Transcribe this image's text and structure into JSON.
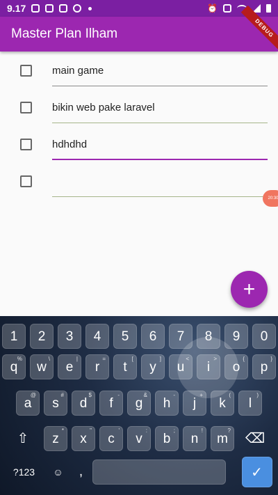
{
  "statusbar": {
    "time": "9.17"
  },
  "appbar": {
    "title": "Master Plan Ilham",
    "debug": "DEBUG"
  },
  "tasks": [
    {
      "text": "main game"
    },
    {
      "text": "bikin web pake laravel"
    },
    {
      "text": "hdhdhd"
    },
    {
      "text": ""
    }
  ],
  "bubble": {
    "text": "20:30"
  },
  "fab": {
    "label": "+"
  },
  "keyboard": {
    "numbers": [
      "1",
      "2",
      "3",
      "4",
      "5",
      "6",
      "7",
      "8",
      "9",
      "0"
    ],
    "row_q": [
      {
        "k": "q",
        "h": "%"
      },
      {
        "k": "w",
        "h": "\\"
      },
      {
        "k": "e",
        "h": "|"
      },
      {
        "k": "r",
        "h": "="
      },
      {
        "k": "t",
        "h": "["
      },
      {
        "k": "y",
        "h": "]"
      },
      {
        "k": "u",
        "h": "<"
      },
      {
        "k": "i",
        "h": ">"
      },
      {
        "k": "o",
        "h": "{"
      },
      {
        "k": "p",
        "h": "}"
      }
    ],
    "row_a": [
      {
        "k": "a",
        "h": "@"
      },
      {
        "k": "s",
        "h": "#"
      },
      {
        "k": "d",
        "h": "$"
      },
      {
        "k": "f",
        "h": "-"
      },
      {
        "k": "g",
        "h": "&"
      },
      {
        "k": "h",
        "h": "-"
      },
      {
        "k": "j",
        "h": "+"
      },
      {
        "k": "k",
        "h": "("
      },
      {
        "k": "l",
        "h": ")"
      }
    ],
    "row_z": [
      {
        "k": "z",
        "h": "*"
      },
      {
        "k": "x",
        "h": "\""
      },
      {
        "k": "c",
        "h": "'"
      },
      {
        "k": "v",
        "h": ":"
      },
      {
        "k": "b",
        "h": ";"
      },
      {
        "k": "n",
        "h": "!"
      },
      {
        "k": "m",
        "h": "?"
      }
    ],
    "shift": "⇧",
    "backspace": "⌫",
    "sym": "?123",
    "emoji": "☺",
    "comma": ",",
    "done": "✓"
  }
}
